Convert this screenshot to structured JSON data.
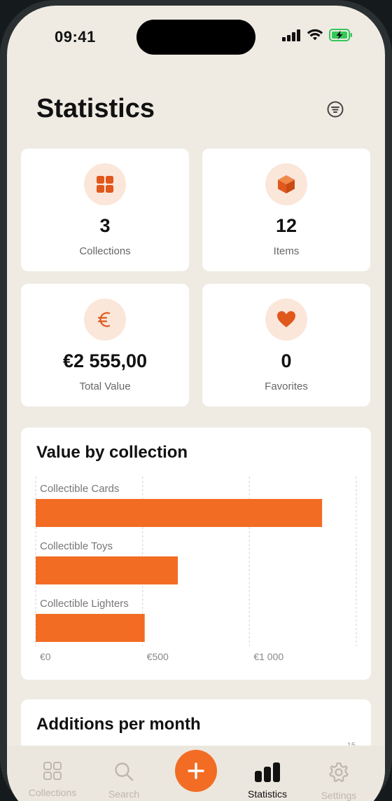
{
  "status_bar": {
    "time": "09:41"
  },
  "header": {
    "title": "Statistics"
  },
  "stats": [
    {
      "value": "3",
      "label": "Collections",
      "icon": "grid-icon"
    },
    {
      "value": "12",
      "label": "Items",
      "icon": "cube-icon"
    },
    {
      "value": "€2 555,00",
      "label": "Total Value",
      "icon": "euro-icon"
    },
    {
      "value": "0",
      "label": "Favorites",
      "icon": "heart-icon"
    }
  ],
  "chart_data": {
    "type": "bar",
    "orientation": "horizontal",
    "title": "Value by collection",
    "categories": [
      "Collectible Cards",
      "Collectible Toys",
      "Collectible Lighters"
    ],
    "values": [
      1340,
      665,
      510
    ],
    "xlim": [
      0,
      1500
    ],
    "xticks": [
      0,
      500,
      1000
    ],
    "xtick_labels": [
      "€0",
      "€500",
      "€1 000"
    ],
    "bar_color": "#f26c24",
    "grid": true
  },
  "additions": {
    "title": "Additions per month",
    "tick_top": "15"
  },
  "tabbar": {
    "tabs": [
      {
        "label": "Collections",
        "icon": "grid-icon"
      },
      {
        "label": "Search",
        "icon": "search-icon"
      },
      {
        "label": "Statistics",
        "icon": "bar-chart-icon"
      },
      {
        "label": "Settings",
        "icon": "gear-icon"
      }
    ],
    "add_icon": "plus-icon"
  },
  "colors": {
    "accent": "#f26c24",
    "accent_soft": "#fbe6da",
    "background": "#efebe3"
  }
}
